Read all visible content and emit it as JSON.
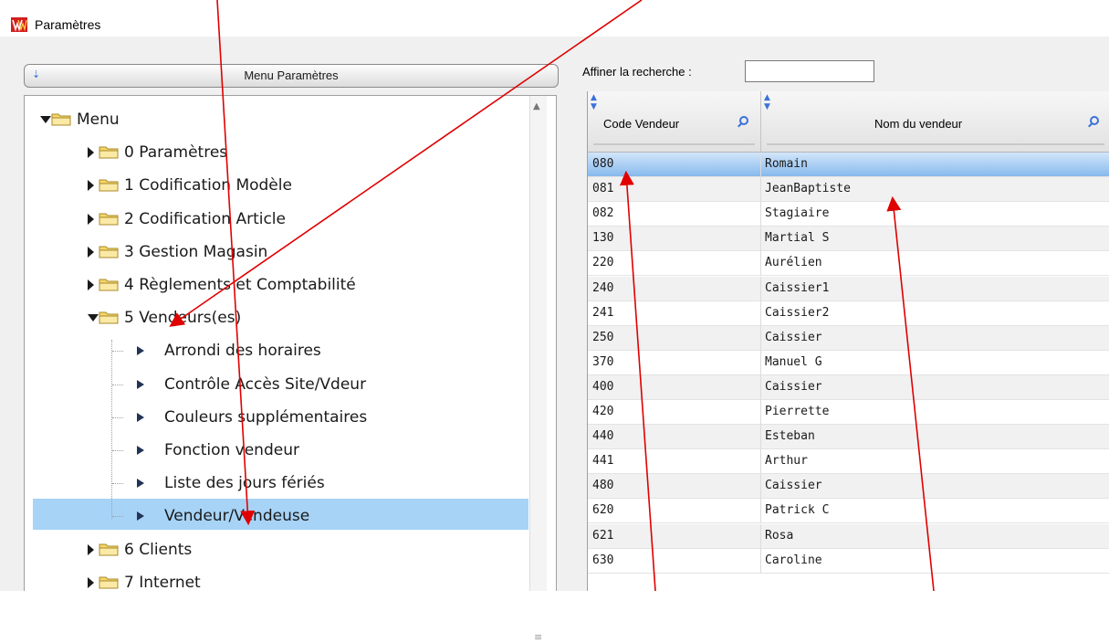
{
  "window": {
    "title": "Paramètres"
  },
  "menu_panel": {
    "header_title": "Menu Paramètres",
    "tree": [
      {
        "label": "Menu",
        "level": 0,
        "kind": "folder",
        "state": "expanded"
      },
      {
        "label": "0 Paramètres",
        "level": 1,
        "kind": "folder",
        "state": "collapsed"
      },
      {
        "label": "1 Codification Modèle",
        "level": 1,
        "kind": "folder",
        "state": "collapsed"
      },
      {
        "label": "2 Codification Article",
        "level": 1,
        "kind": "folder",
        "state": "collapsed"
      },
      {
        "label": "3 Gestion Magasin",
        "level": 1,
        "kind": "folder",
        "state": "collapsed"
      },
      {
        "label": "4 Règlements et Comptabilité",
        "level": 1,
        "kind": "folder",
        "state": "collapsed"
      },
      {
        "label": "5 Vendeurs(es)",
        "level": 1,
        "kind": "folder",
        "state": "expanded"
      },
      {
        "label": "Arrondi des horaires",
        "level": 2,
        "kind": "leaf"
      },
      {
        "label": "Contrôle Accès Site/Vdeur",
        "level": 2,
        "kind": "leaf"
      },
      {
        "label": "Couleurs supplémentaires",
        "level": 2,
        "kind": "leaf"
      },
      {
        "label": "Fonction vendeur",
        "level": 2,
        "kind": "leaf"
      },
      {
        "label": "Liste des jours fériés",
        "level": 2,
        "kind": "leaf"
      },
      {
        "label": "Vendeur/Vendeuse",
        "level": 2,
        "kind": "leaf",
        "selected": true
      },
      {
        "label": "6 Clients",
        "level": 1,
        "kind": "folder",
        "state": "collapsed"
      },
      {
        "label": "7 Internet",
        "level": 1,
        "kind": "folder",
        "state": "collapsed"
      }
    ]
  },
  "search": {
    "label": "Affiner la recherche :",
    "value": ""
  },
  "grid": {
    "columns": [
      "Code Vendeur",
      "Nom du vendeur"
    ],
    "selected_index": 0,
    "rows": [
      [
        "080",
        "Romain"
      ],
      [
        "081",
        "JeanBaptiste"
      ],
      [
        "082",
        "Stagiaire"
      ],
      [
        "130",
        "Martial S"
      ],
      [
        "220",
        "Aurélien"
      ],
      [
        "240",
        "Caissier1"
      ],
      [
        "241",
        "Caissier2"
      ],
      [
        "250",
        "Caissier"
      ],
      [
        "370",
        "Manuel G"
      ],
      [
        "400",
        "Caissier"
      ],
      [
        "420",
        "Pierrette"
      ],
      [
        "440",
        "Esteban"
      ],
      [
        "441",
        "Arthur"
      ],
      [
        "480",
        "Caissier"
      ],
      [
        "620",
        "Patrick C"
      ],
      [
        "621",
        "Rosa"
      ],
      [
        "630",
        "Caroline"
      ]
    ]
  },
  "icons": {
    "app_logo": "app-logo-icon",
    "folder": "folder-icon",
    "leaf": "leaf-arrow-icon",
    "sort": "sort-icon",
    "column_search": "magnifier-icon"
  },
  "colors": {
    "annotation_red": "#e00000",
    "selection_blue": "#a7d3f7",
    "folder_fill": "#f5d66b",
    "accent": "#3a72d8"
  }
}
